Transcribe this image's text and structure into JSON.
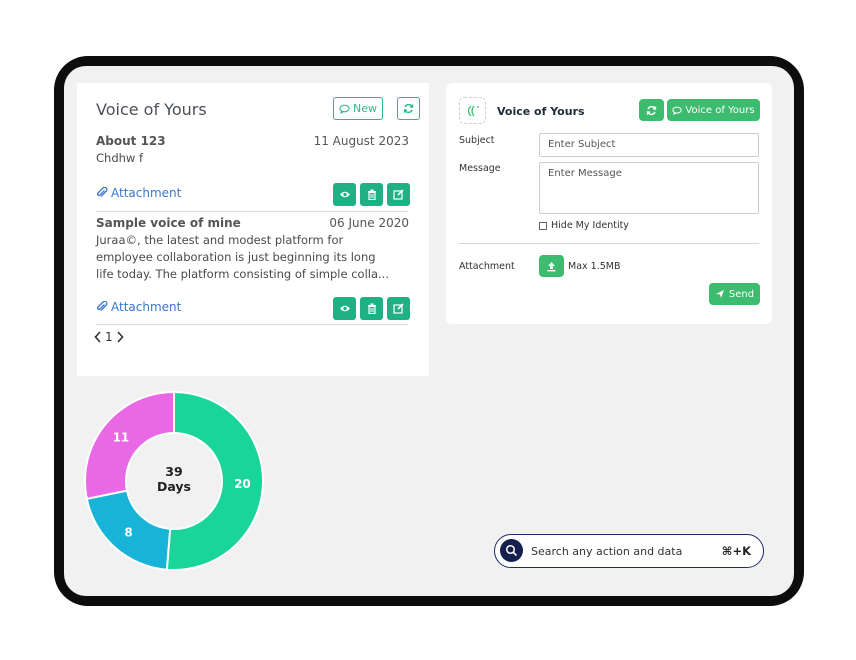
{
  "voice_list": {
    "title": "Voice of Yours",
    "new_label": "New",
    "items": [
      {
        "title": "About 123",
        "date": "11 August 2023",
        "body": "Chdhw f",
        "attachment_label": "Attachment"
      },
      {
        "title": "Sample voice of mine",
        "date": "06 June 2020",
        "body": "Juraa©, the latest and modest platform for employee collaboration is just beginning its long life today. The platform consisting of simple colla...",
        "attachment_label": "Attachment"
      }
    ],
    "page": "1"
  },
  "form": {
    "title": "Voice of Yours",
    "voice_button_label": "Voice of Yours",
    "subject_label": "Subject",
    "subject_placeholder": "Enter Subject",
    "message_label": "Message",
    "message_placeholder": "Enter Message",
    "hide_identity_label": "Hide My Identity",
    "attachment_label": "Attachment",
    "max_size": "Max 1.5MB",
    "send_label": "Send"
  },
  "chart_data": {
    "type": "pie",
    "donut": true,
    "center_label": [
      "39",
      "Days"
    ],
    "slices": [
      {
        "label": "20",
        "value": 20,
        "color": "#19d59a"
      },
      {
        "label": "8",
        "value": 8,
        "color": "#18b4d8"
      },
      {
        "label": "11",
        "value": 11,
        "color": "#e968e6"
      }
    ]
  },
  "search": {
    "placeholder": "Search any action and data",
    "shortcut": "⌘+K"
  },
  "colors": {
    "accent": "#1fb084",
    "green": "#3dbb6e",
    "link": "#3a78c9"
  }
}
